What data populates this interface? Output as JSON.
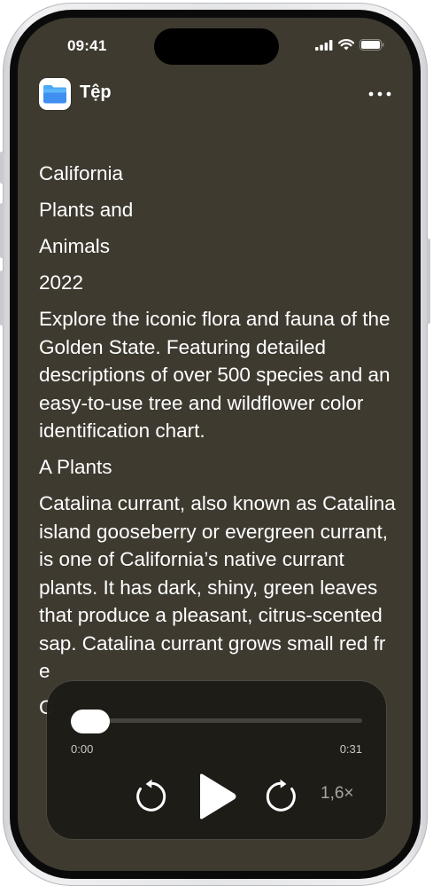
{
  "status_bar": {
    "time": "09:41"
  },
  "app": {
    "title": "Tệp"
  },
  "document": {
    "lines": [
      "California",
      "Plants and",
      "Animals",
      "2022",
      "Explore the iconic flora and fauna of the Golden State. Featuring detailed descriptions of over 500 species and an easy-to-use tree and wildflower color identification chart.",
      "A Plants",
      "Catalina currant, also known as Catalina island gooseberry or evergreen currant, is one of California’s native currant plants. It has dark, shiny, green leaves that produce a pleasant, citrus-scented sap. Catalina currant grows small red fr",
      "e",
      "C"
    ]
  },
  "player": {
    "elapsed": "0:00",
    "duration": "0:31",
    "speed": "1,6×",
    "progress": 0.0
  },
  "colors": {
    "screen_bg": "#3e3a30",
    "player_bg": "#1c1b17",
    "text": "#ffffff"
  },
  "icons": [
    "signal-icon",
    "wifi-icon",
    "battery-icon",
    "files-app-icon",
    "more-icon",
    "skip-back-icon",
    "play-icon",
    "skip-forward-icon"
  ]
}
